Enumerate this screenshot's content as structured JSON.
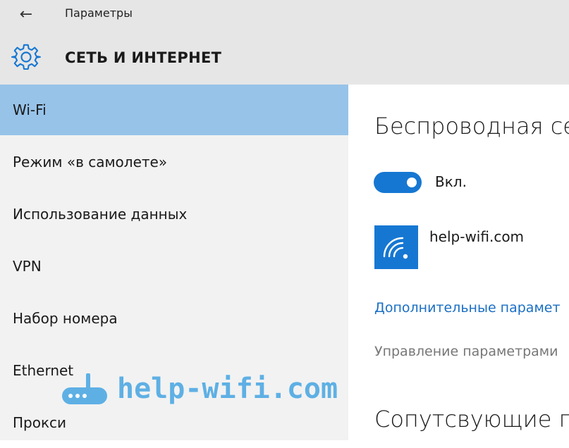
{
  "window": {
    "app_title": "Параметры",
    "back_icon": "arrow-left-icon",
    "back_glyph": "←",
    "section_icon": "gear-icon",
    "section_title": "СЕТЬ И ИНТЕРНЕТ"
  },
  "colors": {
    "titlebar_bg": "#e6e6e6",
    "sidebar_bg": "#f2f2f2",
    "active_item_bg": "#97c3e9",
    "accent": "#1677d2",
    "link": "#1a6fc4",
    "watermark": "#4fa9e3"
  },
  "sidebar": {
    "items": [
      {
        "label": "Wi-Fi",
        "active": true
      },
      {
        "label": "Режим «в самолете»",
        "active": false
      },
      {
        "label": "Использование данных",
        "active": false
      },
      {
        "label": "VPN",
        "active": false
      },
      {
        "label": "Набор номера",
        "active": false
      },
      {
        "label": "Ethernet",
        "active": false
      },
      {
        "label": "Прокси",
        "active": false
      }
    ]
  },
  "main": {
    "heading": "Беспроводная се",
    "toggle": {
      "state": "on",
      "label": "Вкл."
    },
    "network": {
      "icon": "wifi-icon",
      "name": "help-wifi.com"
    },
    "advanced_link": "Дополнительные парамет",
    "manage_text": "Управление параметрами",
    "related_heading": "Сопутсвующие п"
  },
  "watermark": {
    "icon": "router-icon",
    "text": "help-wifi.com"
  }
}
